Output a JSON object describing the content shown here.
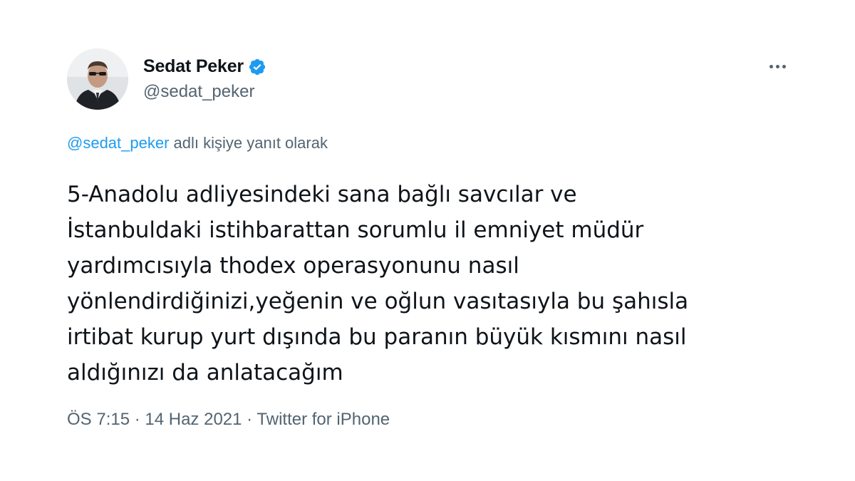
{
  "author": {
    "display_name": "Sedat Peker",
    "handle": "@sedat_peker",
    "verified": true,
    "avatar_icon": "user-avatar"
  },
  "reply": {
    "mention": "@sedat_peker",
    "suffix": " adlı kişiye yanıt olarak"
  },
  "tweet": {
    "text": "5-Anadolu adliyesindeki sana bağlı savcılar ve\nİstanbuldaki istihbarattan sorumlu il emniyet müdür\nyardımcısıyla thodex operasyonunu nasıl\nyönlendirdiğinizi,yeğenin ve oğlun vasıtasıyla bu şahısla\nirtibat kurup yurt dışında bu paranın büyük kısmını nasıl\naldığınızı da anlatacağım"
  },
  "meta": {
    "time": "ÖS 7:15",
    "separator1": " · ",
    "date": "14 Haz 2021",
    "separator2": " · ",
    "source": "Twitter for iPhone"
  },
  "colors": {
    "accent": "#1d9bf0",
    "text": "#0f1419",
    "secondary": "#536471"
  },
  "icons": {
    "verified": "verified-badge-icon",
    "more": "more-options-icon"
  }
}
